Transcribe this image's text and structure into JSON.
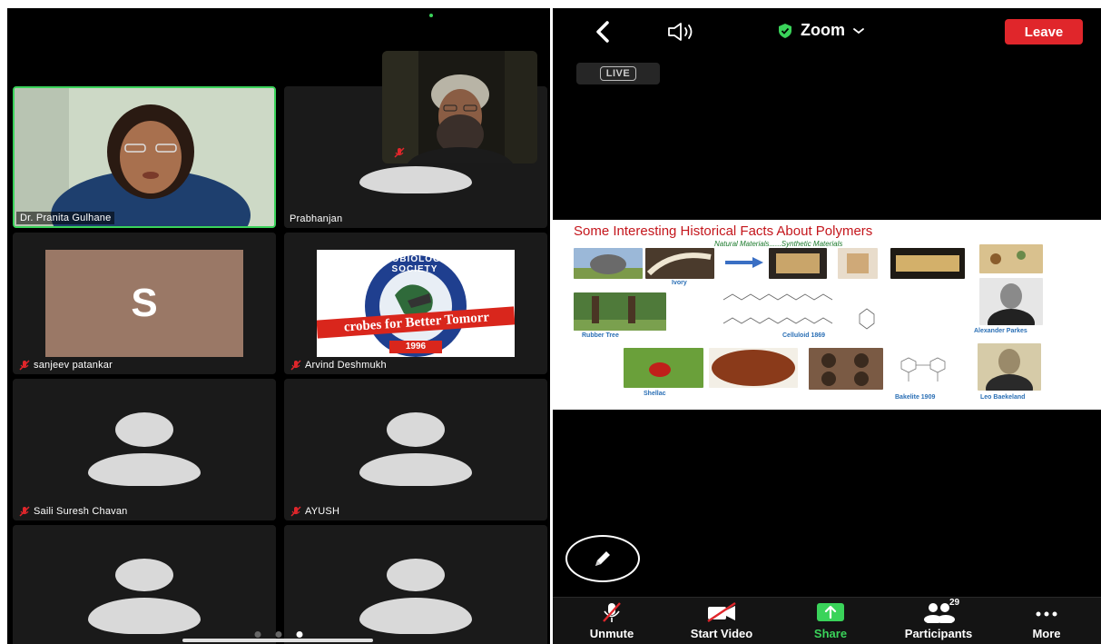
{
  "gallery": {
    "tiles": [
      {
        "name": "Dr. Pranita Gulhane",
        "muted": false,
        "active": true
      },
      {
        "name": "Prabhanjan",
        "muted": false,
        "active": false
      },
      {
        "name": "sanjeev patankar",
        "muted": true,
        "initial": "S",
        "initial_bg": "#9a7866"
      },
      {
        "name": "Arvind Deshmukh",
        "muted": true
      },
      {
        "name": "Saili Suresh Chavan",
        "muted": true
      },
      {
        "name": "AYUSH",
        "muted": true
      },
      {
        "name": "",
        "muted": false
      },
      {
        "name": "",
        "muted": false
      }
    ],
    "logo": {
      "top_text": "MICROBIOLOGISTS SOCIETY",
      "banner_text": "crobes for Better Tomorr",
      "year": "1996"
    },
    "page_dots": {
      "count": 3,
      "active_index": 2
    }
  },
  "meeting": {
    "title": "Zoom",
    "leave_label": "Leave",
    "live_label": "LIVE",
    "slide": {
      "title": "Some Interesting Historical Facts About Polymers",
      "subtitle": "Natural Materials......Synthetic Materials",
      "captions": {
        "ivory": "Ivory",
        "rubber": "Rubber Tree",
        "celluloid": "Celluloid 1869",
        "parkes": "Alexander Parkes",
        "shellac": "Shellac",
        "bakelite": "Bakelite 1909",
        "baekeland": "Leo Baekeland"
      }
    },
    "toolbar": {
      "unmute": "Unmute",
      "start_video": "Start Video",
      "share": "Share",
      "participants": "Participants",
      "participants_count": "29",
      "more": "More"
    }
  },
  "colors": {
    "active_border": "#3ad35a",
    "leave_red": "#e0262b",
    "share_green": "#3ad35a",
    "slide_title_red": "#c4161c"
  }
}
